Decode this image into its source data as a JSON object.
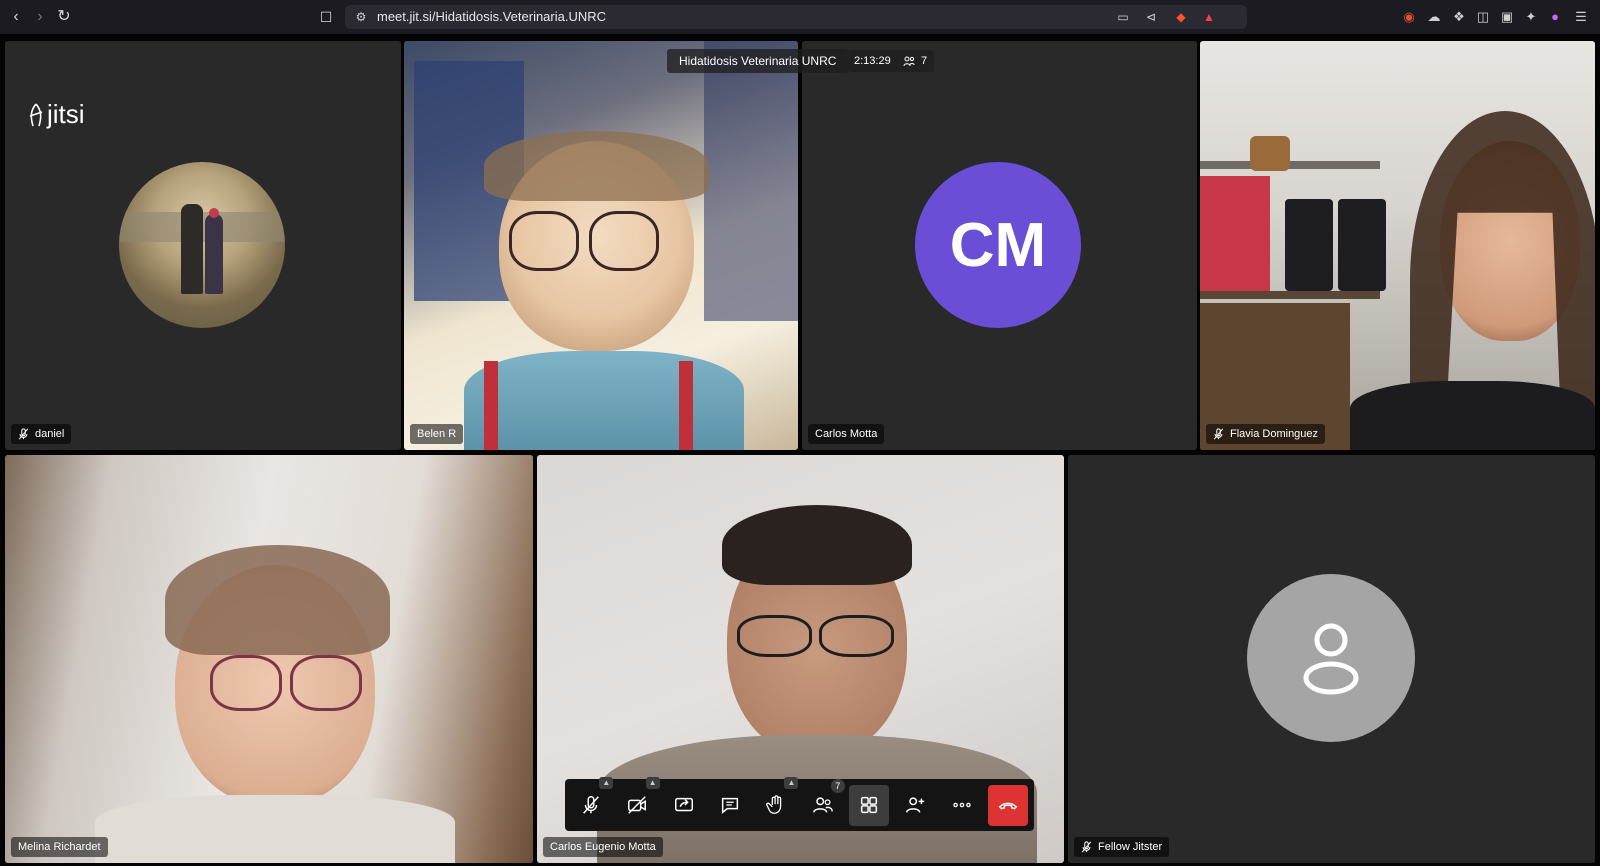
{
  "browser": {
    "url": "meet.jit.si/Hidatidosis.Veterinaria.UNRC"
  },
  "meeting": {
    "logo_text": "jitsi",
    "title": "Hidatidosis Veterinaria UNRC",
    "timer": "2:13:29",
    "participant_count": "7"
  },
  "participants": [
    {
      "name": "daniel",
      "muted": true
    },
    {
      "name": "Belen R",
      "muted": false
    },
    {
      "name": "Carlos Motta",
      "muted": false,
      "initials": "CM",
      "avatar_color": "#6a4fd6"
    },
    {
      "name": "Flavia Dominguez",
      "muted": true
    },
    {
      "name": "Melina Richardet",
      "muted": false
    },
    {
      "name": "Carlos Eugenio Motta",
      "muted": false
    },
    {
      "name": "Fellow Jitster",
      "muted": true
    }
  ],
  "toolbar": {
    "participants_badge": "7"
  },
  "colors": {
    "tile_bg": "#292929",
    "active_border": "#4687ed",
    "hangup": "#dd3333"
  }
}
